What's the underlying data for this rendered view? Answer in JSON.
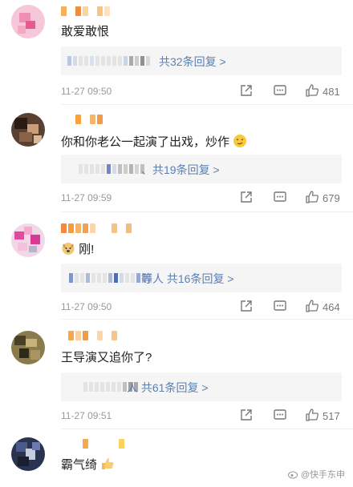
{
  "comments": [
    {
      "text": "敢爱敢恨",
      "reply_label": "共32条回复 >",
      "time": "11-27 09:50",
      "likes": "481"
    },
    {
      "text": "你和你老公一起演了出戏，炒作",
      "reply_label": "、共19条回复 >",
      "time": "11-27 09:59",
      "likes": "679"
    },
    {
      "text": "刚!",
      "reply_label": "等人  共16条回复 >",
      "time": "11-27 09:50",
      "likes": "464"
    },
    {
      "text": "王导演又追你了?",
      "reply_label": "人  共61条回复 >",
      "time": "11-27 09:51",
      "likes": "517"
    },
    {
      "text": "霸气绮"
    }
  ],
  "watermark": "@快手东申",
  "icons": {
    "share": "share-icon",
    "comment": "comment-icon",
    "like": "thumbs-up-icon"
  },
  "colors": {
    "link": "#5a7fb5",
    "time": "#999999"
  }
}
